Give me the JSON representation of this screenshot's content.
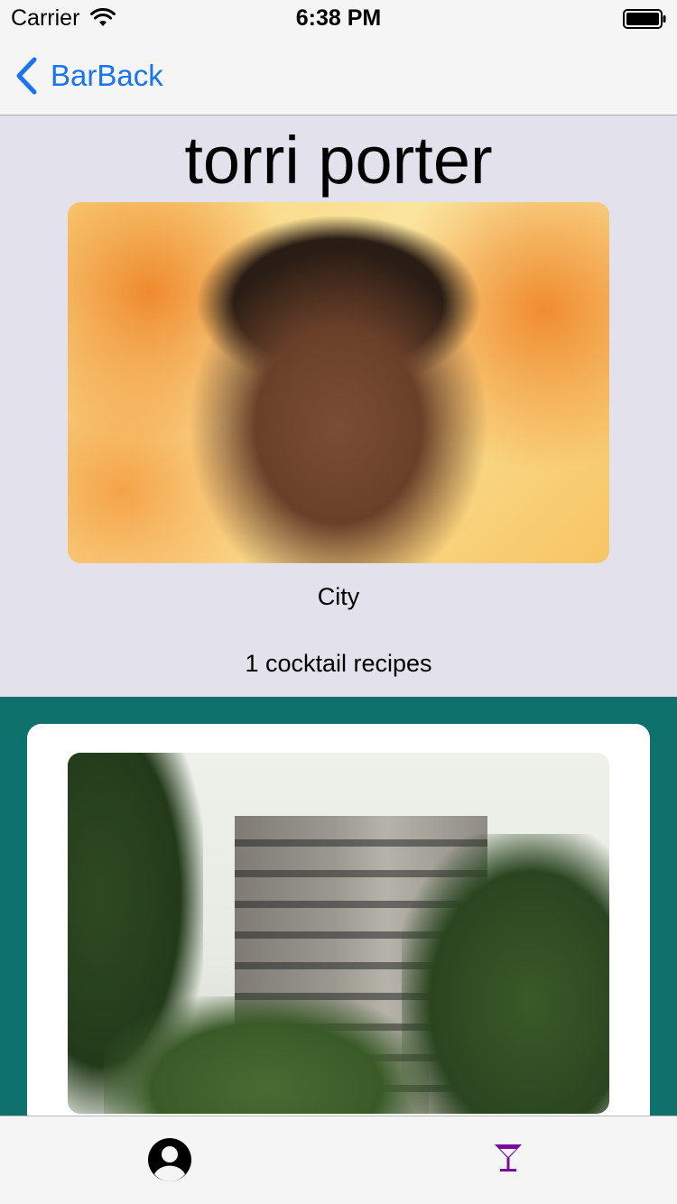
{
  "status_bar": {
    "carrier": "Carrier",
    "time": "6:38 PM"
  },
  "nav": {
    "back_label": "BarBack"
  },
  "profile": {
    "name": "torri porter",
    "city": "City",
    "recipes_count_label": "1 cocktail recipes"
  },
  "recipes": [
    {
      "image": "building-photo"
    }
  ],
  "tab_bar": {
    "items": [
      {
        "icon": "person-icon",
        "active": false
      },
      {
        "icon": "cocktail-icon",
        "active": true
      }
    ],
    "active_color": "#7b0aa0"
  },
  "colors": {
    "accent": "#1a74f0",
    "profile_background": "#e3e1ec",
    "recipes_background": "#0f716c"
  }
}
